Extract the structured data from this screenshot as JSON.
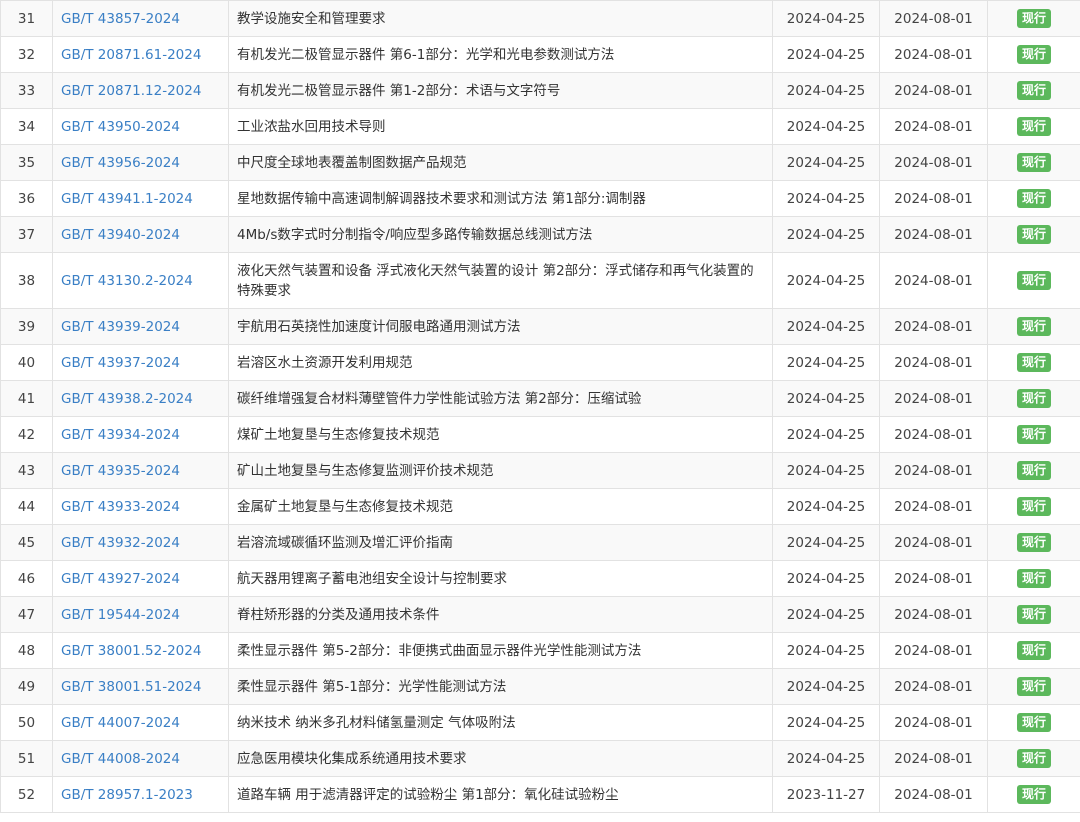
{
  "table": {
    "rows": [
      {
        "no": "31",
        "code": "GB/T 43857-2024",
        "name": "教学设施安全和管理要求",
        "release": "2024-04-25",
        "implement": "2024-08-01",
        "status": "现行"
      },
      {
        "no": "32",
        "code": "GB/T 20871.61-2024",
        "name": "有机发光二极管显示器件 第6-1部分：光学和光电参数测试方法",
        "release": "2024-04-25",
        "implement": "2024-08-01",
        "status": "现行"
      },
      {
        "no": "33",
        "code": "GB/T 20871.12-2024",
        "name": "有机发光二极管显示器件 第1-2部分：术语与文字符号",
        "release": "2024-04-25",
        "implement": "2024-08-01",
        "status": "现行"
      },
      {
        "no": "34",
        "code": "GB/T 43950-2024",
        "name": "工业浓盐水回用技术导则",
        "release": "2024-04-25",
        "implement": "2024-08-01",
        "status": "现行"
      },
      {
        "no": "35",
        "code": "GB/T 43956-2024",
        "name": "中尺度全球地表覆盖制图数据产品规范",
        "release": "2024-04-25",
        "implement": "2024-08-01",
        "status": "现行"
      },
      {
        "no": "36",
        "code": "GB/T 43941.1-2024",
        "name": "星地数据传输中高速调制解调器技术要求和测试方法 第1部分:调制器",
        "release": "2024-04-25",
        "implement": "2024-08-01",
        "status": "现行"
      },
      {
        "no": "37",
        "code": "GB/T 43940-2024",
        "name": "4Mb/s数字式时分制指令/响应型多路传输数据总线测试方法",
        "release": "2024-04-25",
        "implement": "2024-08-01",
        "status": "现行"
      },
      {
        "no": "38",
        "code": "GB/T 43130.2-2024",
        "name": "液化天然气装置和设备 浮式液化天然气装置的设计 第2部分：浮式储存和再气化装置的特殊要求",
        "release": "2024-04-25",
        "implement": "2024-08-01",
        "status": "现行"
      },
      {
        "no": "39",
        "code": "GB/T 43939-2024",
        "name": "宇航用石英挠性加速度计伺服电路通用测试方法",
        "release": "2024-04-25",
        "implement": "2024-08-01",
        "status": "现行"
      },
      {
        "no": "40",
        "code": "GB/T 43937-2024",
        "name": "岩溶区水土资源开发利用规范",
        "release": "2024-04-25",
        "implement": "2024-08-01",
        "status": "现行"
      },
      {
        "no": "41",
        "code": "GB/T 43938.2-2024",
        "name": "碳纤维增强复合材料薄壁管件力学性能试验方法 第2部分：压缩试验",
        "release": "2024-04-25",
        "implement": "2024-08-01",
        "status": "现行"
      },
      {
        "no": "42",
        "code": "GB/T 43934-2024",
        "name": "煤矿土地复垦与生态修复技术规范",
        "release": "2024-04-25",
        "implement": "2024-08-01",
        "status": "现行"
      },
      {
        "no": "43",
        "code": "GB/T 43935-2024",
        "name": "矿山土地复垦与生态修复监测评价技术规范",
        "release": "2024-04-25",
        "implement": "2024-08-01",
        "status": "现行"
      },
      {
        "no": "44",
        "code": "GB/T 43933-2024",
        "name": "金属矿土地复垦与生态修复技术规范",
        "release": "2024-04-25",
        "implement": "2024-08-01",
        "status": "现行"
      },
      {
        "no": "45",
        "code": "GB/T 43932-2024",
        "name": "岩溶流域碳循环监测及增汇评价指南",
        "release": "2024-04-25",
        "implement": "2024-08-01",
        "status": "现行"
      },
      {
        "no": "46",
        "code": "GB/T 43927-2024",
        "name": "航天器用锂离子蓄电池组安全设计与控制要求",
        "release": "2024-04-25",
        "implement": "2024-08-01",
        "status": "现行"
      },
      {
        "no": "47",
        "code": "GB/T 19544-2024",
        "name": "脊柱矫形器的分类及通用技术条件",
        "release": "2024-04-25",
        "implement": "2024-08-01",
        "status": "现行"
      },
      {
        "no": "48",
        "code": "GB/T 38001.52-2024",
        "name": "柔性显示器件 第5-2部分：非便携式曲面显示器件光学性能测试方法",
        "release": "2024-04-25",
        "implement": "2024-08-01",
        "status": "现行"
      },
      {
        "no": "49",
        "code": "GB/T 38001.51-2024",
        "name": "柔性显示器件 第5-1部分：光学性能测试方法",
        "release": "2024-04-25",
        "implement": "2024-08-01",
        "status": "现行"
      },
      {
        "no": "50",
        "code": "GB/T 44007-2024",
        "name": "纳米技术 纳米多孔材料储氢量测定 气体吸附法",
        "release": "2024-04-25",
        "implement": "2024-08-01",
        "status": "现行"
      },
      {
        "no": "51",
        "code": "GB/T 44008-2024",
        "name": "应急医用模块化集成系统通用技术要求",
        "release": "2024-04-25",
        "implement": "2024-08-01",
        "status": "现行"
      },
      {
        "no": "52",
        "code": "GB/T 28957.1-2023",
        "name": "道路车辆 用于滤清器评定的试验粉尘 第1部分：氧化硅试验粉尘",
        "release": "2023-11-27",
        "implement": "2024-08-01",
        "status": "现行"
      }
    ]
  },
  "colors": {
    "link": "#3a7fc5",
    "status_badge": "#5cb85c",
    "row_alt": "#f9f9f9",
    "border": "#e2e2e2"
  }
}
